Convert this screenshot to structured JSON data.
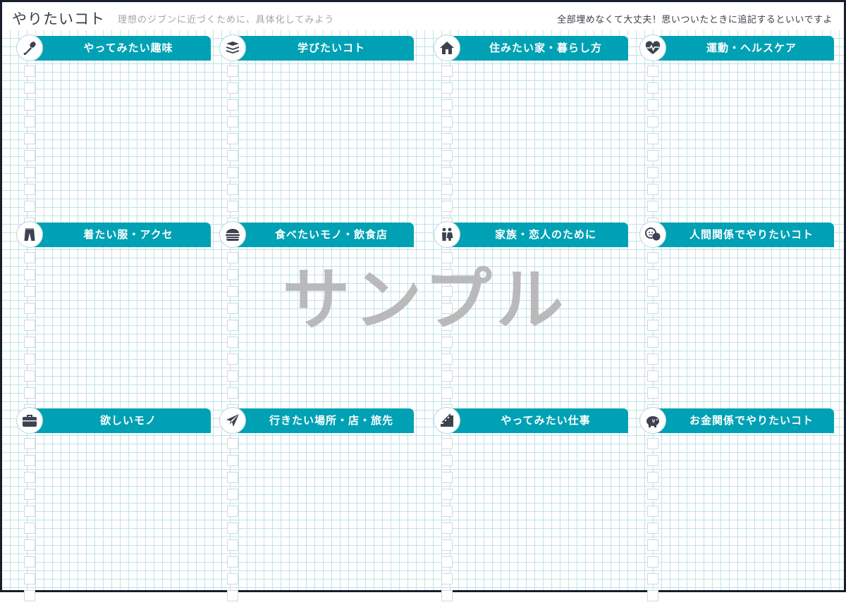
{
  "header": {
    "title": "やりたいコト",
    "subtitle": "理想のジブンに近づくために、具体化してみよう",
    "note": "全部埋めなくて大丈夫！思いついたときに追記するといいですよ"
  },
  "colors": {
    "accent": "#00a1b4",
    "icon": "#3d4250",
    "grid": "#bfe3e8",
    "watermark": "#b3b3b3"
  },
  "sections": [
    {
      "label": "やってみたい趣味",
      "icon": "microphone-icon"
    },
    {
      "label": "学びたいコト",
      "icon": "books-icon"
    },
    {
      "label": "住みたい家・暮らし方",
      "icon": "house-icon"
    },
    {
      "label": "運動・ヘルスケア",
      "icon": "heartbeat-icon"
    },
    {
      "label": "着たい服・アクセ",
      "icon": "pants-icon"
    },
    {
      "label": "食べたいモノ・飲食店",
      "icon": "hamburger-icon"
    },
    {
      "label": "家族・恋人のために",
      "icon": "couple-icon"
    },
    {
      "label": "人間関係でやりたいコト",
      "icon": "chat-faces-icon"
    },
    {
      "label": "欲しいモノ",
      "icon": "briefcase-icon"
    },
    {
      "label": "行きたい場所・店・旅先",
      "icon": "airplane-icon"
    },
    {
      "label": "やってみたい仕事",
      "icon": "stairs-icon"
    },
    {
      "label": "お金関係でやりたいコト",
      "icon": "piggy-bank-icon"
    }
  ],
  "checkbox_count_per_section": 10,
  "watermark": "サンプル"
}
